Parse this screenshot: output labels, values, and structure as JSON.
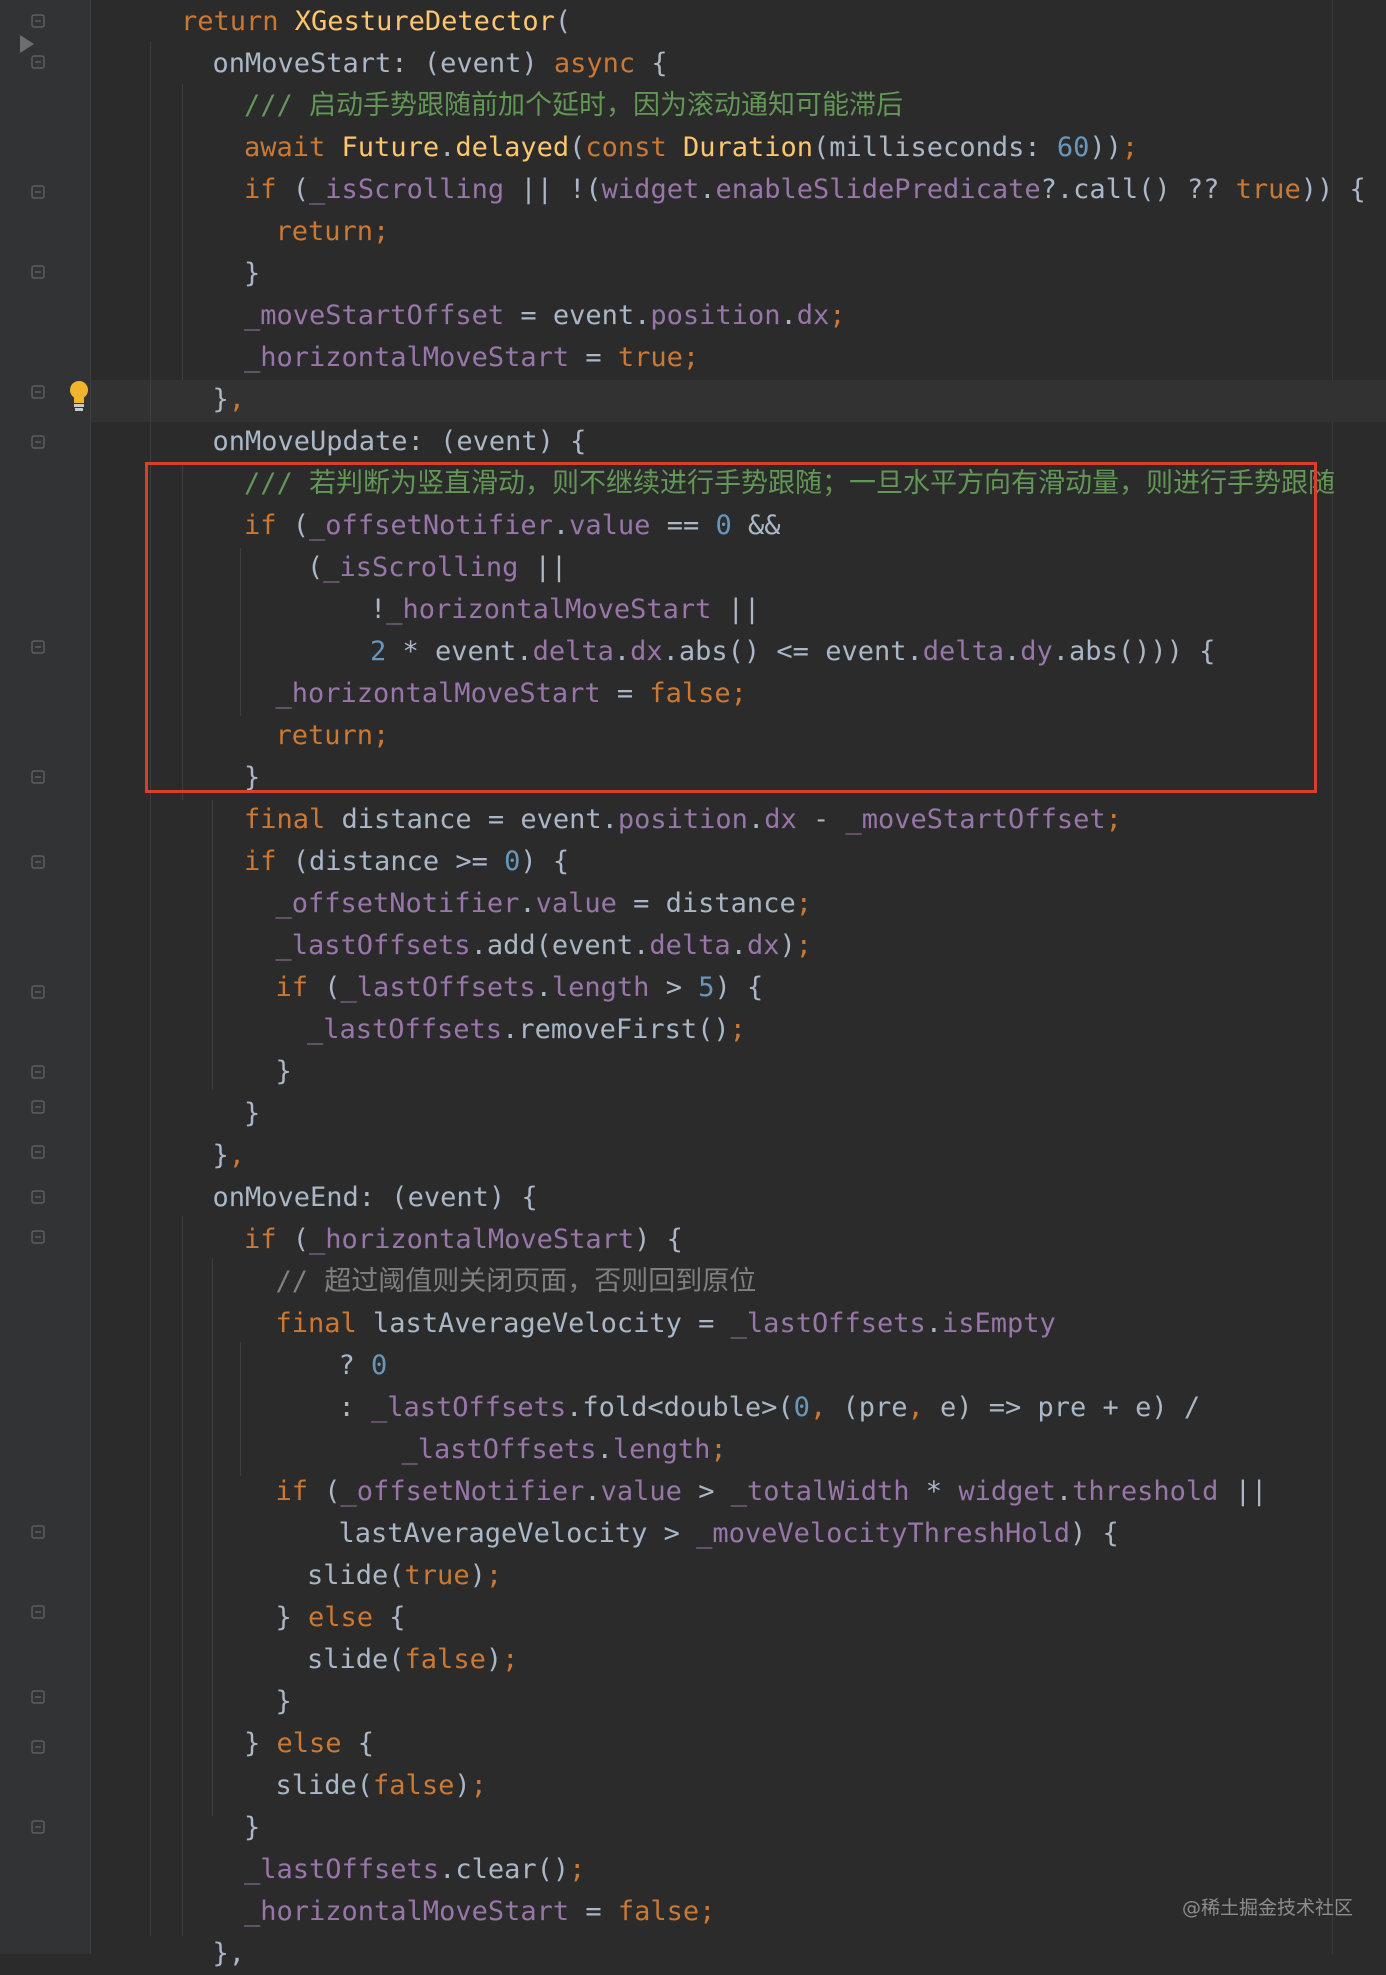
{
  "colors": {
    "keyword": "#cc7832",
    "type": "#ffc66d",
    "field": "#9876aa",
    "number": "#6897bb",
    "doc_comment": "#629755",
    "comment": "#808080",
    "plain": "#a9b7c6",
    "highlight_box": "#d8402c"
  },
  "icons": {
    "run": "run-triangle-icon",
    "bulb": "lightbulb-icon",
    "fold": "fold-marker-icon"
  },
  "watermark": "@稀土掘金技术社区",
  "code_lines": [
    {
      "indent": 3,
      "tokens": [
        [
          "return ",
          "k"
        ],
        [
          "XGestureDetector",
          "t"
        ],
        [
          "(",
          "p"
        ]
      ]
    },
    {
      "indent": 4,
      "tokens": [
        [
          "onMoveStart: (event) ",
          "p"
        ],
        [
          "async",
          "k"
        ],
        [
          " {",
          "p"
        ]
      ]
    },
    {
      "indent": 5,
      "tokens": [
        [
          "/// 启动手势跟随前加个延时，因为滚动通知可能滞后",
          "d"
        ]
      ]
    },
    {
      "indent": 5,
      "tokens": [
        [
          "await ",
          "k"
        ],
        [
          "Future",
          "t"
        ],
        [
          ".",
          "p"
        ],
        [
          "delayed",
          "t"
        ],
        [
          "(",
          "p"
        ],
        [
          "const ",
          "k"
        ],
        [
          "Duration",
          "t"
        ],
        [
          "(milliseconds: ",
          "p"
        ],
        [
          "60",
          "n"
        ],
        [
          "))",
          "p"
        ],
        [
          ";",
          "k"
        ]
      ]
    },
    {
      "indent": 5,
      "tokens": [
        [
          "if ",
          "k"
        ],
        [
          "(",
          "p"
        ],
        [
          "_isScrolling",
          "f"
        ],
        [
          " || !(",
          "p"
        ],
        [
          "widget",
          "f"
        ],
        [
          ".",
          "p"
        ],
        [
          "enableSlidePredicate",
          "f"
        ],
        [
          "?.call() ?? ",
          "p"
        ],
        [
          "true",
          "k"
        ],
        [
          ")) {",
          "p"
        ]
      ]
    },
    {
      "indent": 6,
      "tokens": [
        [
          "return;",
          "k"
        ]
      ]
    },
    {
      "indent": 5,
      "tokens": [
        [
          "}",
          "p"
        ]
      ]
    },
    {
      "indent": 5,
      "tokens": [
        [
          "_moveStartOffset",
          "f"
        ],
        [
          " = event.",
          "p"
        ],
        [
          "position",
          "f"
        ],
        [
          ".",
          "p"
        ],
        [
          "dx",
          "f"
        ],
        [
          ";",
          "k"
        ]
      ]
    },
    {
      "indent": 5,
      "tokens": [
        [
          "_horizontalMoveStart",
          "f"
        ],
        [
          " = ",
          "p"
        ],
        [
          "true;",
          "k"
        ]
      ]
    },
    {
      "indent": 4,
      "tokens": [
        [
          "}",
          "p"
        ],
        [
          ",",
          "k"
        ]
      ]
    },
    {
      "indent": 4,
      "tokens": [
        [
          "onMoveUpdate: (event) {",
          "p"
        ]
      ]
    },
    {
      "indent": 5,
      "tokens": [
        [
          "/// 若判断为竖直滑动，则不继续进行手势跟随；一旦水平方向有滑动量，则进行手势跟随",
          "d"
        ]
      ]
    },
    {
      "indent": 5,
      "tokens": [
        [
          "if ",
          "k"
        ],
        [
          "(",
          "p"
        ],
        [
          "_offsetNotifier",
          "f"
        ],
        [
          ".",
          "p"
        ],
        [
          "value",
          "f"
        ],
        [
          " == ",
          "p"
        ],
        [
          "0",
          "n"
        ],
        [
          " &&",
          "p"
        ]
      ]
    },
    {
      "indent": 7,
      "tokens": [
        [
          "(",
          "p"
        ],
        [
          "_isScrolling",
          "f"
        ],
        [
          " ||",
          "p"
        ]
      ]
    },
    {
      "indent": 9,
      "tokens": [
        [
          "!",
          "p"
        ],
        [
          "_horizontalMoveStart",
          "f"
        ],
        [
          " ||",
          "p"
        ]
      ]
    },
    {
      "indent": 9,
      "tokens": [
        [
          "2",
          "n"
        ],
        [
          " * event.",
          "p"
        ],
        [
          "delta",
          "f"
        ],
        [
          ".",
          "p"
        ],
        [
          "dx",
          "f"
        ],
        [
          ".abs() <= event.",
          "p"
        ],
        [
          "delta",
          "f"
        ],
        [
          ".",
          "p"
        ],
        [
          "dy",
          "f"
        ],
        [
          ".abs())) {",
          "p"
        ]
      ]
    },
    {
      "indent": 6,
      "tokens": [
        [
          "_horizontalMoveStart",
          "f"
        ],
        [
          " = ",
          "p"
        ],
        [
          "false;",
          "k"
        ]
      ]
    },
    {
      "indent": 6,
      "tokens": [
        [
          "return;",
          "k"
        ]
      ]
    },
    {
      "indent": 5,
      "tokens": [
        [
          "}",
          "p"
        ]
      ]
    },
    {
      "indent": 5,
      "tokens": [
        [
          "final ",
          "k"
        ],
        [
          "distance = event.",
          "p"
        ],
        [
          "position",
          "f"
        ],
        [
          ".",
          "p"
        ],
        [
          "dx",
          "f"
        ],
        [
          " - ",
          "p"
        ],
        [
          "_moveStartOffset",
          "f"
        ],
        [
          ";",
          "k"
        ]
      ]
    },
    {
      "indent": 5,
      "tokens": [
        [
          "if ",
          "k"
        ],
        [
          "(distance >= ",
          "p"
        ],
        [
          "0",
          "n"
        ],
        [
          ") {",
          "p"
        ]
      ]
    },
    {
      "indent": 6,
      "tokens": [
        [
          "_offsetNotifier",
          "f"
        ],
        [
          ".",
          "p"
        ],
        [
          "value",
          "f"
        ],
        [
          " = distance",
          "p"
        ],
        [
          ";",
          "k"
        ]
      ]
    },
    {
      "indent": 6,
      "tokens": [
        [
          "_lastOffsets",
          "f"
        ],
        [
          ".add(event.",
          "p"
        ],
        [
          "delta",
          "f"
        ],
        [
          ".",
          "p"
        ],
        [
          "dx",
          "f"
        ],
        [
          ")",
          "p"
        ],
        [
          ";",
          "k"
        ]
      ]
    },
    {
      "indent": 6,
      "tokens": [
        [
          "if ",
          "k"
        ],
        [
          "(",
          "p"
        ],
        [
          "_lastOffsets",
          "f"
        ],
        [
          ".",
          "p"
        ],
        [
          "length",
          "f"
        ],
        [
          " > ",
          "p"
        ],
        [
          "5",
          "n"
        ],
        [
          ") {",
          "p"
        ]
      ]
    },
    {
      "indent": 7,
      "tokens": [
        [
          "_lastOffsets",
          "f"
        ],
        [
          ".removeFirst()",
          "p"
        ],
        [
          ";",
          "k"
        ]
      ]
    },
    {
      "indent": 6,
      "tokens": [
        [
          "}",
          "p"
        ]
      ]
    },
    {
      "indent": 5,
      "tokens": [
        [
          "}",
          "p"
        ]
      ]
    },
    {
      "indent": 4,
      "tokens": [
        [
          "}",
          "p"
        ],
        [
          ",",
          "k"
        ]
      ]
    },
    {
      "indent": 4,
      "tokens": [
        [
          "onMoveEnd: (event) {",
          "p"
        ]
      ]
    },
    {
      "indent": 5,
      "tokens": [
        [
          "if ",
          "k"
        ],
        [
          "(",
          "p"
        ],
        [
          "_horizontalMoveStart",
          "f"
        ],
        [
          ") {",
          "p"
        ]
      ]
    },
    {
      "indent": 6,
      "tokens": [
        [
          "// 超过阈值则关闭页面，否则回到原位",
          "c"
        ]
      ]
    },
    {
      "indent": 6,
      "tokens": [
        [
          "final ",
          "k"
        ],
        [
          "lastAverageVelocity = ",
          "p"
        ],
        [
          "_lastOffsets",
          "f"
        ],
        [
          ".",
          "p"
        ],
        [
          "isEmpty",
          "f"
        ]
      ]
    },
    {
      "indent": 8,
      "tokens": [
        [
          "? ",
          "p"
        ],
        [
          "0",
          "n"
        ]
      ]
    },
    {
      "indent": 8,
      "tokens": [
        [
          ": ",
          "p"
        ],
        [
          "_lastOffsets",
          "f"
        ],
        [
          ".fold<double>(",
          "p"
        ],
        [
          "0",
          "n"
        ],
        [
          ", ",
          "k"
        ],
        [
          "(pre",
          "p"
        ],
        [
          ", ",
          "k"
        ],
        [
          "e) => pre + e) /",
          "p"
        ]
      ]
    },
    {
      "indent": 10,
      "tokens": [
        [
          "_lastOffsets",
          "f"
        ],
        [
          ".",
          "p"
        ],
        [
          "length",
          "f"
        ],
        [
          ";",
          "k"
        ]
      ]
    },
    {
      "indent": 6,
      "tokens": [
        [
          "if ",
          "k"
        ],
        [
          "(",
          "p"
        ],
        [
          "_offsetNotifier",
          "f"
        ],
        [
          ".",
          "p"
        ],
        [
          "value",
          "f"
        ],
        [
          " > ",
          "p"
        ],
        [
          "_totalWidth",
          "f"
        ],
        [
          " * ",
          "p"
        ],
        [
          "widget",
          "f"
        ],
        [
          ".",
          "p"
        ],
        [
          "threshold",
          "f"
        ],
        [
          " ||",
          "p"
        ]
      ]
    },
    {
      "indent": 8,
      "tokens": [
        [
          "lastAverageVelocity > ",
          "p"
        ],
        [
          "_moveVelocityThreshHold",
          "f"
        ],
        [
          ") {",
          "p"
        ]
      ]
    },
    {
      "indent": 7,
      "tokens": [
        [
          "slide(",
          "p"
        ],
        [
          "true",
          "k"
        ],
        [
          ")",
          "p"
        ],
        [
          ";",
          "k"
        ]
      ]
    },
    {
      "indent": 6,
      "tokens": [
        [
          "} ",
          "p"
        ],
        [
          "else ",
          "k"
        ],
        [
          "{",
          "p"
        ]
      ]
    },
    {
      "indent": 7,
      "tokens": [
        [
          "slide(",
          "p"
        ],
        [
          "false",
          "k"
        ],
        [
          ")",
          "p"
        ],
        [
          ";",
          "k"
        ]
      ]
    },
    {
      "indent": 6,
      "tokens": [
        [
          "}",
          "p"
        ]
      ]
    },
    {
      "indent": 5,
      "tokens": [
        [
          "} ",
          "p"
        ],
        [
          "else ",
          "k"
        ],
        [
          "{",
          "p"
        ]
      ]
    },
    {
      "indent": 6,
      "tokens": [
        [
          "slide(",
          "p"
        ],
        [
          "false",
          "k"
        ],
        [
          ")",
          "p"
        ],
        [
          ";",
          "k"
        ]
      ]
    },
    {
      "indent": 5,
      "tokens": [
        [
          "}",
          "p"
        ]
      ]
    },
    {
      "indent": 5,
      "tokens": [
        [
          "_lastOffsets",
          "f"
        ],
        [
          ".clear()",
          "p"
        ],
        [
          ";",
          "k"
        ]
      ]
    },
    {
      "indent": 5,
      "tokens": [
        [
          "_horizontalMoveStart",
          "f"
        ],
        [
          " = ",
          "p"
        ],
        [
          "false;",
          "k"
        ]
      ]
    },
    {
      "indent": 4,
      "tokens": [
        [
          "},",
          "p"
        ]
      ]
    }
  ]
}
